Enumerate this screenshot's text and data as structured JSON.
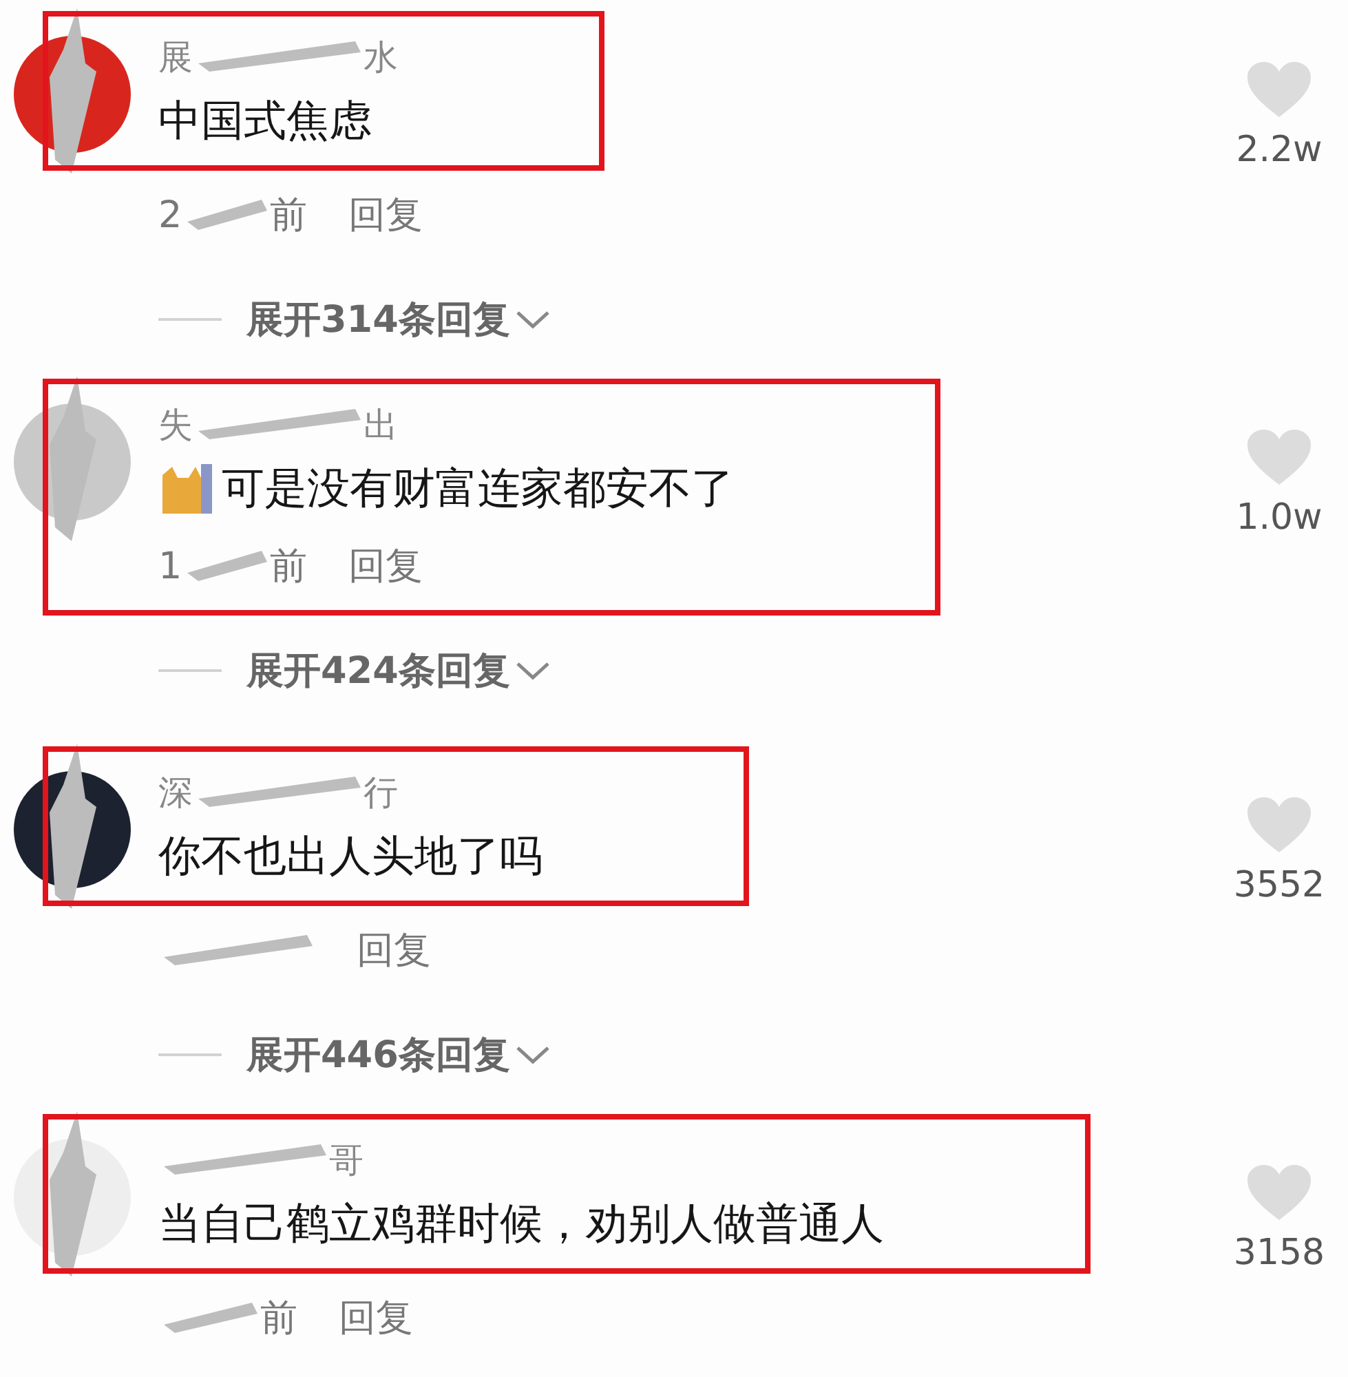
{
  "comments": [
    {
      "color": "#d8261e",
      "name_parts": [
        "展",
        "水"
      ],
      "text": "中国式焦虑",
      "kind": "plain",
      "time_parts": [
        "2",
        "前"
      ],
      "reply": "回复",
      "likes": "2.2w",
      "expand": "展开314条回复",
      "highlighted": true,
      "highlight_includes_time": false
    },
    {
      "color": "#c9c9c9",
      "name_parts": [
        "失",
        "出"
      ],
      "text": "可是没有财富连家都安不了",
      "kind": "cat_sticker",
      "time_parts": [
        "1",
        "前"
      ],
      "reply": "回复",
      "likes": "1.0w",
      "expand": "展开424条回复",
      "highlighted": true,
      "highlight_includes_time": true
    },
    {
      "color": "#1c2230",
      "name_parts": [
        "深",
        "行"
      ],
      "text": "你不也出人头地了吗",
      "kind": "plain",
      "reply": "回复",
      "likes": "3552",
      "expand": "展开446条回复",
      "highlighted": true,
      "highlight_includes_time": false
    },
    {
      "color": "#eeeeee",
      "name_parts": [
        "哥"
      ],
      "text": "当自己鹤立鸡群时候，劝别人做普通人",
      "kind": "plain",
      "time_parts": [
        "前"
      ],
      "reply": "回复",
      "likes": "3158",
      "highlighted": true,
      "highlight_includes_time": false
    }
  ]
}
